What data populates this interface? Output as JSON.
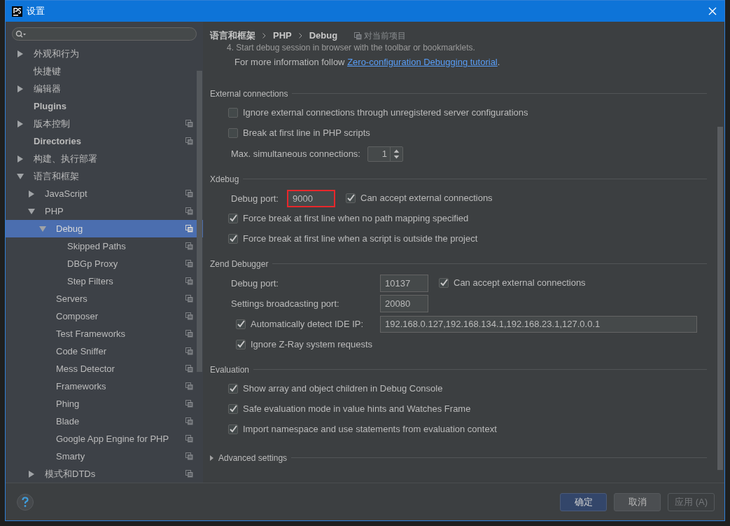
{
  "window": {
    "title": "设置"
  },
  "sidebar": {
    "items": [
      {
        "label": "外观和行为",
        "bold": false,
        "expanded": false,
        "has_children": true,
        "selected": false,
        "project_scoped": false
      },
      {
        "label": "快捷键",
        "bold": false,
        "expanded": false,
        "has_children": false,
        "selected": false,
        "project_scoped": false
      },
      {
        "label": "编辑器",
        "bold": false,
        "expanded": false,
        "has_children": true,
        "selected": false,
        "project_scoped": false
      },
      {
        "label": "Plugins",
        "bold": true,
        "expanded": false,
        "has_children": false,
        "selected": false,
        "project_scoped": false
      },
      {
        "label": "版本控制",
        "bold": false,
        "expanded": false,
        "has_children": true,
        "selected": false,
        "project_scoped": true
      },
      {
        "label": "Directories",
        "bold": true,
        "expanded": false,
        "has_children": false,
        "selected": false,
        "project_scoped": true
      },
      {
        "label": "构建、执行部署",
        "bold": false,
        "expanded": false,
        "has_children": true,
        "selected": false,
        "project_scoped": false
      },
      {
        "label": "语言和框架",
        "bold": false,
        "expanded": true,
        "has_children": true,
        "selected": false,
        "project_scoped": false,
        "children": [
          {
            "label": "JavaScript",
            "bold": false,
            "expanded": false,
            "has_children": true,
            "selected": false,
            "project_scoped": true
          },
          {
            "label": "PHP",
            "bold": false,
            "expanded": true,
            "has_children": true,
            "selected": false,
            "project_scoped": true,
            "children": [
              {
                "label": "Debug",
                "bold": false,
                "expanded": true,
                "has_children": true,
                "selected": true,
                "project_scoped": true,
                "children": [
                  {
                    "label": "Skipped Paths",
                    "bold": false,
                    "expanded": false,
                    "has_children": false,
                    "selected": false,
                    "project_scoped": true
                  },
                  {
                    "label": "DBGp Proxy",
                    "bold": false,
                    "expanded": false,
                    "has_children": false,
                    "selected": false,
                    "project_scoped": true
                  },
                  {
                    "label": "Step Filters",
                    "bold": false,
                    "expanded": false,
                    "has_children": false,
                    "selected": false,
                    "project_scoped": true
                  }
                ]
              },
              {
                "label": "Servers",
                "bold": false,
                "expanded": false,
                "has_children": false,
                "selected": false,
                "project_scoped": true
              },
              {
                "label": "Composer",
                "bold": false,
                "expanded": false,
                "has_children": false,
                "selected": false,
                "project_scoped": true
              },
              {
                "label": "Test Frameworks",
                "bold": false,
                "expanded": false,
                "has_children": false,
                "selected": false,
                "project_scoped": true
              },
              {
                "label": "Code Sniffer",
                "bold": false,
                "expanded": false,
                "has_children": false,
                "selected": false,
                "project_scoped": true
              },
              {
                "label": "Mess Detector",
                "bold": false,
                "expanded": false,
                "has_children": false,
                "selected": false,
                "project_scoped": true
              },
              {
                "label": "Frameworks",
                "bold": false,
                "expanded": false,
                "has_children": false,
                "selected": false,
                "project_scoped": true
              },
              {
                "label": "Phing",
                "bold": false,
                "expanded": false,
                "has_children": false,
                "selected": false,
                "project_scoped": true
              },
              {
                "label": "Blade",
                "bold": false,
                "expanded": false,
                "has_children": false,
                "selected": false,
                "project_scoped": true
              },
              {
                "label": "Google App Engine for PHP",
                "bold": false,
                "expanded": false,
                "has_children": false,
                "selected": false,
                "project_scoped": true
              },
              {
                "label": "Smarty",
                "bold": false,
                "expanded": false,
                "has_children": false,
                "selected": false,
                "project_scoped": true
              }
            ]
          },
          {
            "label": "模式和DTDs",
            "bold": false,
            "expanded": false,
            "has_children": true,
            "selected": false,
            "project_scoped": true
          }
        ]
      }
    ]
  },
  "breadcrumb": [
    "语言和框架",
    "PHP",
    "Debug"
  ],
  "scope_note": "对当前项目",
  "intro": {
    "cut_line": "4. Start debug session in browser with the toolbar or bookmarklets.",
    "text": "For more information follow ",
    "link": "Zero-configuration Debugging tutorial",
    "after": "."
  },
  "sections": [
    {
      "title": "External connections",
      "rows": [
        {
          "kind": "checkbox",
          "label": "Ignore external connections through unregistered server configurations",
          "checked": false
        },
        {
          "kind": "checkbox",
          "label": "Break at first line in PHP scripts",
          "checked": false
        },
        {
          "kind": "spinner",
          "label": "Max. simultaneous connections:",
          "value": "1"
        }
      ]
    },
    {
      "title": "Xdebug",
      "rows": [
        {
          "kind": "port",
          "label": "Debug port:",
          "value": "9000",
          "highlighted": true,
          "option": {
            "label": "Can accept external connections",
            "checked": true
          }
        },
        {
          "kind": "checkbox",
          "label": "Force break at first line when no path mapping specified",
          "checked": true
        },
        {
          "kind": "checkbox",
          "label": "Force break at first line when a script is outside the project",
          "checked": true
        }
      ]
    },
    {
      "title": "Zend Debugger",
      "rows": [
        {
          "kind": "field",
          "label": "Debug port:",
          "value": "10137",
          "option": {
            "label": "Can accept external connections",
            "checked": true
          }
        },
        {
          "kind": "field",
          "label": "Settings broadcasting port:",
          "value": "20080"
        },
        {
          "kind": "checkfield",
          "label": "Automatically detect IDE IP:",
          "checked": true,
          "value": "192.168.0.127,192.168.134.1,192.168.23.1,127.0.0.1"
        },
        {
          "kind": "subcheckbox",
          "label": "Ignore Z-Ray system requests",
          "checked": true
        }
      ]
    },
    {
      "title": "Evaluation",
      "rows": [
        {
          "kind": "checkbox",
          "label": "Show array and object children in Debug Console",
          "checked": true
        },
        {
          "kind": "checkbox",
          "label": "Safe evaluation mode in value hints and Watches Frame",
          "checked": true
        },
        {
          "kind": "checkbox",
          "label": "Import namespace and use statements from evaluation context",
          "checked": true
        }
      ]
    }
  ],
  "advanced": {
    "label": "Advanced settings",
    "expanded": false
  },
  "buttons": [
    {
      "label": "确定",
      "kind": "primary",
      "disabled": false
    },
    {
      "label": "取消",
      "kind": "normal",
      "disabled": false
    },
    {
      "label": "应用 (A)",
      "kind": "normal",
      "disabled": true
    }
  ]
}
